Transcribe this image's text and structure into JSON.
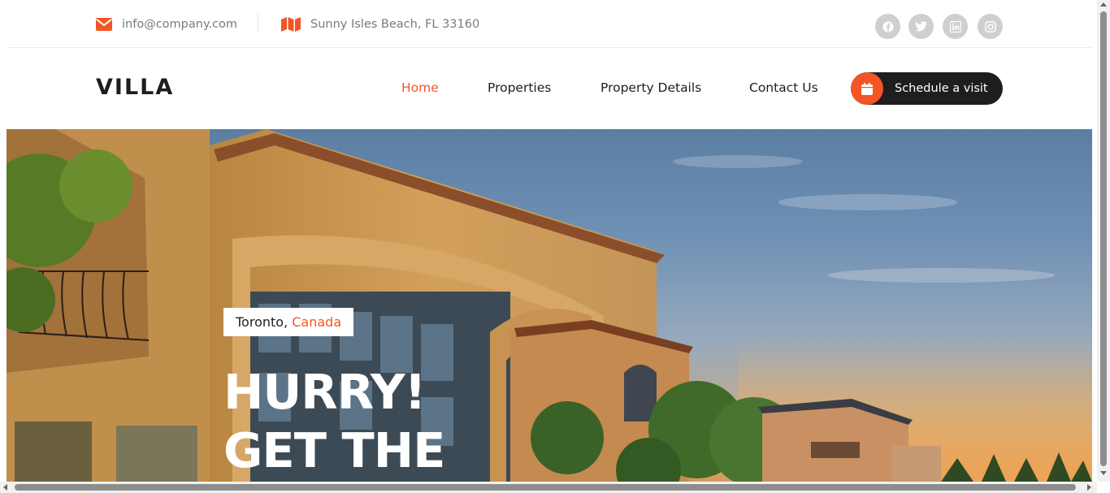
{
  "topbar": {
    "email": "info@company.com",
    "address": "Sunny Isles Beach, FL 33160",
    "social": [
      {
        "icon": "facebook-icon"
      },
      {
        "icon": "twitter-icon"
      },
      {
        "icon": "linkedin-icon"
      },
      {
        "icon": "instagram-icon"
      }
    ]
  },
  "navbar": {
    "logo": "VILLA",
    "links": [
      {
        "label": "Home",
        "active": true
      },
      {
        "label": "Properties",
        "active": false
      },
      {
        "label": "Property Details",
        "active": false
      },
      {
        "label": "Contact Us",
        "active": false
      }
    ],
    "cta_label": "Schedule a visit",
    "cta_icon": "calendar-icon"
  },
  "hero": {
    "city": "Toronto,",
    "country": "Canada",
    "title_line1": "HURRY!",
    "title_line2": "GET THE"
  },
  "colors": {
    "accent": "#f35525",
    "dark": "#1e1e1e",
    "muted_text": "#7a7a7a"
  }
}
